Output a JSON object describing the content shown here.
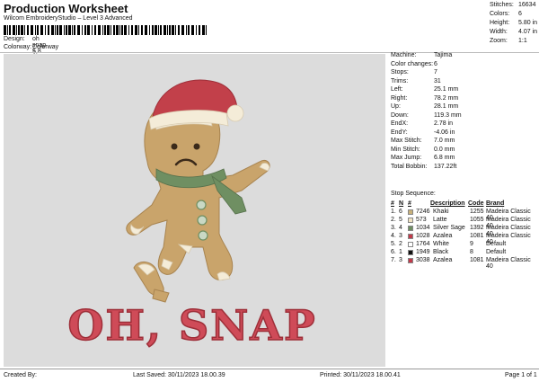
{
  "header": {
    "title": "Production Worksheet",
    "subtitle": "Wilcom EmbroideryStudio – Level 3 Advanced",
    "design_label": "Design:",
    "design_value": "oh snap 5,8 in",
    "colorway_label": "Colorway:",
    "colorway_value": "Colorway 1"
  },
  "stats": [
    {
      "label": "Stitches:",
      "value": "16634"
    },
    {
      "label": "Colors:",
      "value": "6"
    },
    {
      "label": "Height:",
      "value": "5.80 in"
    },
    {
      "label": "Width:",
      "value": "4.07 in"
    },
    {
      "label": "Zoom:",
      "value": "1:1"
    }
  ],
  "design_info": [
    {
      "label": "Machine:",
      "value": "Tajima"
    },
    {
      "label": "Color changes:",
      "value": "6"
    },
    {
      "label": "Stops:",
      "value": "7"
    },
    {
      "label": "Trims:",
      "value": "31"
    },
    {
      "label": "Left:",
      "value": "25.1 mm"
    },
    {
      "label": "Right:",
      "value": "78.2 mm"
    },
    {
      "label": "Up:",
      "value": "28.1 mm"
    },
    {
      "label": "Down:",
      "value": "119.3 mm"
    },
    {
      "label": "EndX:",
      "value": "2.78 in"
    },
    {
      "label": "EndY:",
      "value": "-4.06 in"
    },
    {
      "label": "Max Stitch:",
      "value": "7.0 mm"
    },
    {
      "label": "Min Stitch:",
      "value": "0.0 mm"
    },
    {
      "label": "Max Jump:",
      "value": "6.8 mm"
    },
    {
      "label": "Total Bobbin:",
      "value": "137.22ft"
    }
  ],
  "stop_sequence": {
    "title": "Stop Sequence:",
    "headers": {
      "num": "#",
      "n": "N",
      "color": "#",
      "desc": "Description",
      "code": "Code",
      "brand": "Brand"
    },
    "rows": [
      {
        "num": "1.",
        "n": "6",
        "color": "7246",
        "swatch": "#c8b07a",
        "desc": "Khaki",
        "code": "1255",
        "brand": "Madeira Classic 40"
      },
      {
        "num": "2.",
        "n": "5",
        "color": "573",
        "swatch": "#f0e3c2",
        "desc": "Latte",
        "code": "1055",
        "brand": "Madeira Classic 40"
      },
      {
        "num": "3.",
        "n": "4",
        "color": "1034",
        "swatch": "#6f8f62",
        "desc": "Silver Sage",
        "code": "1392",
        "brand": "Madeira Classic 40"
      },
      {
        "num": "4.",
        "n": "3",
        "color": "1028",
        "swatch": "#c23a4a",
        "desc": "Azalea",
        "code": "1081",
        "brand": "Madeira Classic 40"
      },
      {
        "num": "5.",
        "n": "2",
        "color": "1764",
        "swatch": "#ffffff",
        "desc": "White",
        "code": "9",
        "brand": "Default"
      },
      {
        "num": "6.",
        "n": "1",
        "color": "1949",
        "swatch": "#111111",
        "desc": "Black",
        "code": "8",
        "brand": "Default"
      },
      {
        "num": "7.",
        "n": "3",
        "color": "3038",
        "swatch": "#c23a4a",
        "desc": "Azalea",
        "code": "1081",
        "brand": "Madeira Classic 40"
      }
    ]
  },
  "artwork": {
    "text": "OH, SNAP",
    "colors": {
      "cookie": "#c9a46b",
      "hat": "#c2404a",
      "scarf": "#6f8f62",
      "icing": "#f4ecd8",
      "lettering": "#cf4b58"
    }
  },
  "footer": {
    "created_by": "Created By:",
    "last_saved": "Last Saved: 30/11/2023 18.00.39",
    "printed": "Printed: 30/11/2023 18.00.41",
    "page": "Page 1 of 1"
  }
}
